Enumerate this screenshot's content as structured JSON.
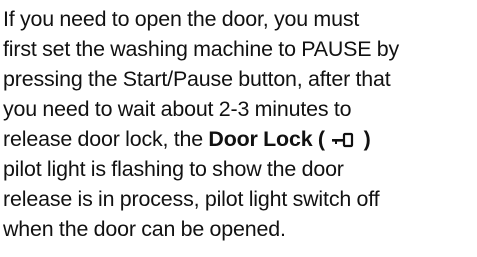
{
  "paragraph": {
    "line1": "If you need to open the door, you must",
    "line2": "first set the washing machine to PAUSE by",
    "line3": "pressing the Start/Pause button, after that",
    "line4": "you need to wait about 2-3 minutes to",
    "line5_pre": "release door lock, the ",
    "door_lock_label": "Door Lock (",
    "door_lock_icon": "key-lock-icon",
    "door_lock_close": ")",
    "line6": "pilot light is flashing to show the door",
    "line7": "release is in process, pilot light switch off",
    "line8": "when the door can be opened."
  }
}
